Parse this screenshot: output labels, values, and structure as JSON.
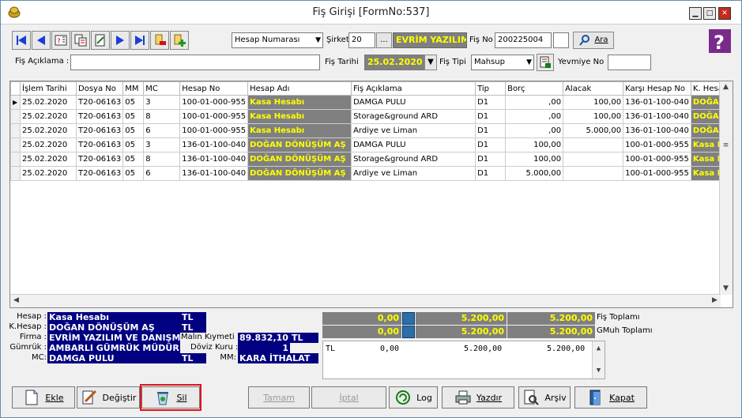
{
  "window": {
    "title": "Fiş Girişi [FormNo:537]",
    "min": "▁",
    "max": "□",
    "close": "✕"
  },
  "top": {
    "search_field": "Hesap Numarası",
    "sirket_label": "Şirket",
    "sirket_value": "20",
    "sirket_more": "...",
    "company": "EVRİM YAZILIM",
    "fisno_label": "Fiş No",
    "fisno_value": "200225004",
    "ara": "Ara"
  },
  "row2": {
    "aciklama_label": "Fiş Açıklama :",
    "aciklama_value": "",
    "tarih_label": "Fiş Tarihi",
    "tarih_value": "25.02.2020",
    "tipi_label": "Fiş Tipi",
    "tipi_value": "Mahsup",
    "yevmiye_label": "Yevmiye No",
    "yevmiye_value": ""
  },
  "grid": {
    "columns": [
      "İşlem Tarihi",
      "Dosya No",
      "MM",
      "MC",
      "Hesap No",
      "Hesap Adı",
      "Fiş Açıklama",
      "Tip",
      "Borç",
      "Alacak",
      "Karşı Hesap No",
      "K. Hesap"
    ],
    "rows": [
      [
        "25.02.2020",
        "T20-06163",
        "05",
        "3",
        "100-01-000-955",
        "Kasa Hesabı",
        "DAMGA PULU",
        "D1",
        ",00",
        "100,00",
        "136-01-100-040",
        "DOĞAN"
      ],
      [
        "25.02.2020",
        "T20-06163",
        "05",
        "8",
        "100-01-000-955",
        "Kasa Hesabı",
        "Storage&ground ARD",
        "D1",
        ",00",
        "100,00",
        "136-01-100-040",
        "DOĞAN"
      ],
      [
        "25.02.2020",
        "T20-06163",
        "05",
        "6",
        "100-01-000-955",
        "Kasa Hesabı",
        "Ardiye ve Liman",
        "D1",
        ",00",
        "5.000,00",
        "136-01-100-040",
        "DOĞAN"
      ],
      [
        "25.02.2020",
        "T20-06163",
        "05",
        "3",
        "136-01-100-040",
        "DOĞAN DÖNÜŞÜM AŞ",
        "DAMGA PULU",
        "D1",
        "100,00",
        "",
        "100-01-000-955",
        "Kasa He"
      ],
      [
        "25.02.2020",
        "T20-06163",
        "05",
        "8",
        "136-01-100-040",
        "DOĞAN DÖNÜŞÜM AŞ",
        "Storage&ground ARD",
        "D1",
        "100,00",
        "",
        "100-01-000-955",
        "Kasa He"
      ],
      [
        "25.02.2020",
        "T20-06163",
        "05",
        "6",
        "136-01-100-040",
        "DOĞAN DÖNÜŞÜM AŞ",
        "Ardiye ve Liman",
        "D1",
        "5.000,00",
        "",
        "100-01-000-955",
        "Kasa He"
      ]
    ]
  },
  "info": {
    "hesap_label": "Hesap :",
    "hesap_value": "Kasa Hesabı",
    "hesap_cur": "TL",
    "khesap_label": "K.Hesap :",
    "khesap_value": "DOĞAN DÖNÜŞÜM AŞ",
    "khesap_cur": "TL",
    "firma_label": "Firma :",
    "firma_value": "EVRİM YAZILIM VE DANIŞMA",
    "gumruk_label": "Gümrük :",
    "gumruk_value": "AMBARLI GÜMRÜK MÜDÜR",
    "mc_label": "MC:",
    "mc_value": "DAMGA PULU",
    "mc_cur": "TL",
    "malin_label": "Malın Kıymeti :",
    "malin_value": "89.832,10",
    "malin_cur": "TL",
    "doviz_label": "Döviz Kuru :",
    "doviz_value": "1",
    "mm_label": "MM:",
    "mm_value": "KARA İTHALAT"
  },
  "totals": {
    "row1": [
      "0,00",
      "5.200,00",
      "5.200,00"
    ],
    "row1_label": "Fiş Toplamı",
    "row2": [
      "0,00",
      "5.200,00",
      "5.200,00"
    ],
    "row2_label": "GMuh Toplamı",
    "memo": [
      "TL",
      "0,00",
      "5.200,00",
      "5.200,00"
    ]
  },
  "buttons": {
    "ekle": "Ekle",
    "degistir": "Değiştir",
    "sil": "Sil",
    "tamam": "Tamam",
    "iptal": "İptal",
    "log": "Log",
    "yazdir": "Yazdır",
    "arsiv": "Arşiv",
    "kapat": "Kapat"
  },
  "colors": {
    "accent_gray": "#808080",
    "highlight_yellow": "#ffff00",
    "info_navy": "#000080",
    "sil_highlight": "#e0131b"
  }
}
